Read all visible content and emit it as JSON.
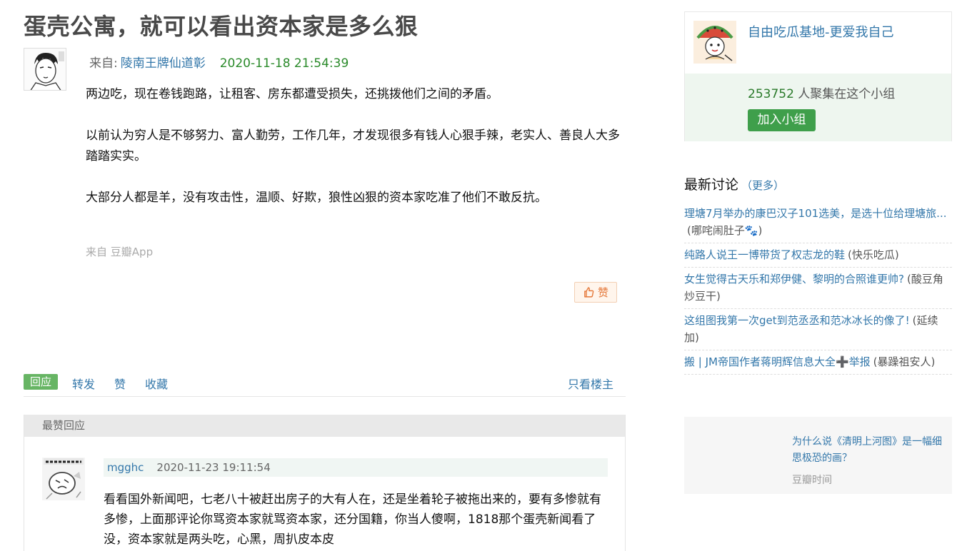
{
  "post": {
    "title": "蛋壳公寓，就可以看出资本家是多么狠",
    "from_label": "来自:",
    "author": "陵南王牌仙道彰",
    "time": "2020-11-18 21:54:39",
    "paragraphs": [
      "两边吃，现在卷钱跑路，让租客、房东都遭受损失，还挑拨他们之间的矛盾。",
      "以前认为穷人是不够努力、富人勤劳，工作几年，才发现很多有钱人心狠手辣，老实人、善良人大多踏踏实实。",
      "大部分人都是羊，没有攻击性，温顺、好欺，狼性凶狠的资本家吃准了他们不敢反抗。"
    ],
    "via_prefix": "来自",
    "via_app": "豆瓣App",
    "like_label": "赞"
  },
  "actions": {
    "reply": "回应",
    "repost": "转发",
    "like": "赞",
    "collect": "收藏",
    "op_only": "只看楼主"
  },
  "best_reply": {
    "header": "最赞回应",
    "user": "mgghc",
    "time": "2020-11-23 19:11:54",
    "text": "看看国外新闻吧，七老八十被赶出房子的大有人在，还是坐着轮子被拖出来的，要有多惨就有多惨，上面那评论你骂资本家就骂资本家，还分国籍，你当人傻啊，1818那个蛋壳新闻看了没，资本家就是两头吃，心黑，周扒皮本皮"
  },
  "group": {
    "name": "自由吃瓜基地-更爱我自己",
    "count": "253752",
    "count_suffix": " 人聚集在这个小组",
    "join_label": "加入小组"
  },
  "latest": {
    "title": "最新讨论",
    "more_open": "（",
    "more": "更多",
    "more_close": "）",
    "topics": [
      {
        "title": "理塘7月举办的康巴汉子101选美，是选十位给理塘旅...",
        "source": "(哪咤闹肚子🐾)"
      },
      {
        "title": "纯路人说王一博带货了权志龙的鞋",
        "source": "(快乐吃瓜)"
      },
      {
        "title": "女生觉得古天乐和郑伊健、黎明的合照谁更帅?",
        "source": "(酸豆角炒豆干)"
      },
      {
        "title": "这组图我第一次get到范丞丞和范冰冰长的像了!",
        "source": "(延续加)"
      },
      {
        "title": "搬 | JM帝国作者蒋明辉信息大全➕举报",
        "source": "(暴躁祖安人)"
      }
    ]
  },
  "ad": {
    "text": "为什么说《清明上河图》是一幅细思极恐的画？",
    "source": "豆瓣时间"
  }
}
